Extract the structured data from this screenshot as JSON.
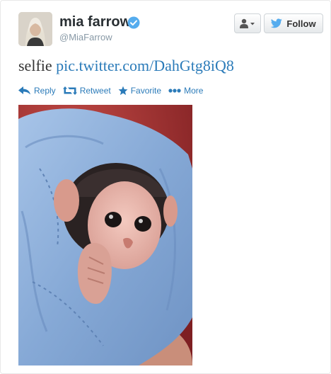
{
  "user": {
    "display_name": "mia farrow",
    "handle": "@MiaFarrow",
    "avatar_icon": "profile-photo",
    "verified_icon": "verified-badge-icon"
  },
  "buttons": {
    "user_menu_icon": "user-dropdown-icon",
    "follow_label": "Follow"
  },
  "tweet": {
    "text": "selfie ",
    "link": "pic.twitter.com/DahGtg8iQ8"
  },
  "actions": [
    {
      "label": "Reply",
      "icon": "reply-icon"
    },
    {
      "label": "Retweet",
      "icon": "retweet-icon"
    },
    {
      "label": "Favorite",
      "icon": "star-icon"
    },
    {
      "label": "More",
      "icon": "more-dots-icon"
    }
  ],
  "colors": {
    "link": "#2b7bb9",
    "verified": "#55acee",
    "blanket": "#8fb3df",
    "background": "#b23a3a"
  }
}
